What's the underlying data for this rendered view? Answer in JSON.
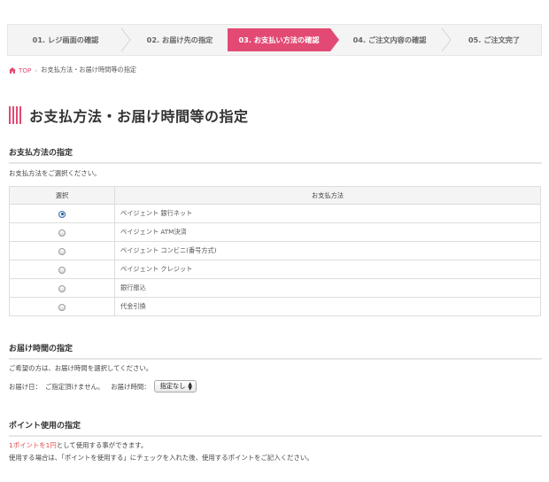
{
  "steps": [
    {
      "label": "01. レジ画面の確認"
    },
    {
      "label": "02. お届け先の指定"
    },
    {
      "label": "03. お支払い方法の確認"
    },
    {
      "label": "04. ご注文内容の確認"
    },
    {
      "label": "05. ご注文完了"
    }
  ],
  "breadcrumb": {
    "home": "TOP",
    "current": "お支払方法・お届け時間等の指定"
  },
  "page_title": "お支払方法・お届け時間等の指定",
  "payment": {
    "heading": "お支払方法の指定",
    "instruction": "お支払方法をご選択ください。",
    "col_select": "選択",
    "col_method": "お支払方法",
    "methods": [
      {
        "name": "ペイジェント 銀行ネット"
      },
      {
        "name": "ペイジェント ATM決済"
      },
      {
        "name": "ペイジェント コンビニ(番号方式)"
      },
      {
        "name": "ペイジェント クレジット"
      },
      {
        "name": "銀行振込"
      },
      {
        "name": "代金引換"
      }
    ]
  },
  "delivery": {
    "heading": "お届け時間の指定",
    "instruction": "ご希望の方は、お届け時間を選択してください。",
    "date_label": "お届け日：",
    "date_value": "ご指定頂けません。",
    "time_label": "お届け時間：",
    "time_selected": "指定なし"
  },
  "points": {
    "heading": "ポイント使用の指定",
    "rate_highlight": "1ポイントを1円",
    "rate_rest": "として使用する事ができます。",
    "usage": "使用する場合は、「ポイントを使用する」にチェックを入れた後、使用するポイントをご記入ください。"
  },
  "colors": {
    "accent": "#e24a74",
    "border": "#dddddd"
  }
}
